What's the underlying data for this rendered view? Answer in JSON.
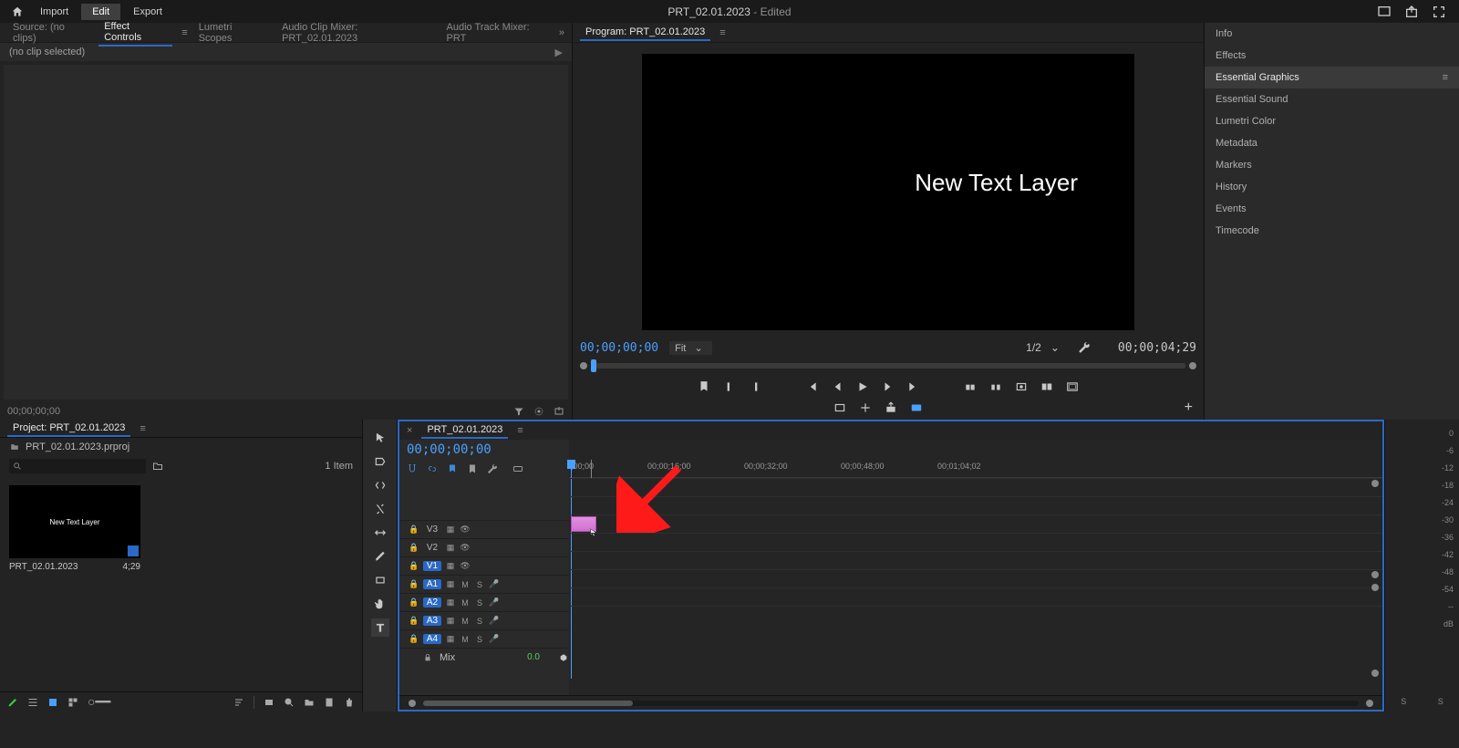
{
  "topbar": {
    "menu": {
      "import": "Import",
      "edit": "Edit",
      "export": "Export"
    },
    "title_main": "PRT_02.01.2023",
    "title_suffix": " -  Edited"
  },
  "source_panel": {
    "tabs": {
      "source": "Source: (no clips)",
      "effect_controls": "Effect Controls",
      "lumetri_scopes": "Lumetri Scopes",
      "audio_clip_mixer": "Audio Clip Mixer: PRT_02.01.2023",
      "audio_track_mixer": "Audio Track Mixer: PRT"
    },
    "no_clip": "(no clip selected)",
    "footer_tc": "00;00;00;00"
  },
  "program_panel": {
    "tab": "Program: PRT_02.01.2023",
    "overlay_text": "New Text Layer",
    "timecode": "00;00;00;00",
    "fit_label": "Fit",
    "resolution": "1/2",
    "duration": "00;00;04;29"
  },
  "right_panel": {
    "items": [
      {
        "label": "Info"
      },
      {
        "label": "Effects"
      },
      {
        "label": "Essential Graphics"
      },
      {
        "label": "Essential Sound"
      },
      {
        "label": "Lumetri Color"
      },
      {
        "label": "Metadata"
      },
      {
        "label": "Markers"
      },
      {
        "label": "History"
      },
      {
        "label": "Events"
      },
      {
        "label": "Timecode"
      }
    ],
    "active_index": 2
  },
  "project_panel": {
    "tab": "Project: PRT_02.01.2023",
    "file": "PRT_02.01.2023.prproj",
    "item_count": "1 Item",
    "clip": {
      "thumb_text": "New Text Layer",
      "name": "PRT_02.01.2023",
      "dur": "4;29"
    }
  },
  "timeline": {
    "tab": "PRT_02.01.2023",
    "timecode": "00;00;00;00",
    "ruler": [
      ";00;00",
      "00;00;16;00",
      "00;00;32;00",
      "00;00;48;00",
      "00;01;04;02"
    ],
    "video_tracks": [
      {
        "name": "V3",
        "on": false
      },
      {
        "name": "V2",
        "on": false
      },
      {
        "name": "V1",
        "on": true
      }
    ],
    "audio_tracks": [
      {
        "name": "A1",
        "on": true
      },
      {
        "name": "A2",
        "on": true
      },
      {
        "name": "A3",
        "on": true
      },
      {
        "name": "A4",
        "on": true
      }
    ],
    "mix_label": "Mix",
    "mix_value": "0.0"
  },
  "meter": {
    "scale": [
      "0",
      "-6",
      "-12",
      "-18",
      "-24",
      "-30",
      "-36",
      "-42",
      "-48",
      "-54",
      "--",
      "dB"
    ],
    "channels": [
      "S",
      "S"
    ]
  }
}
